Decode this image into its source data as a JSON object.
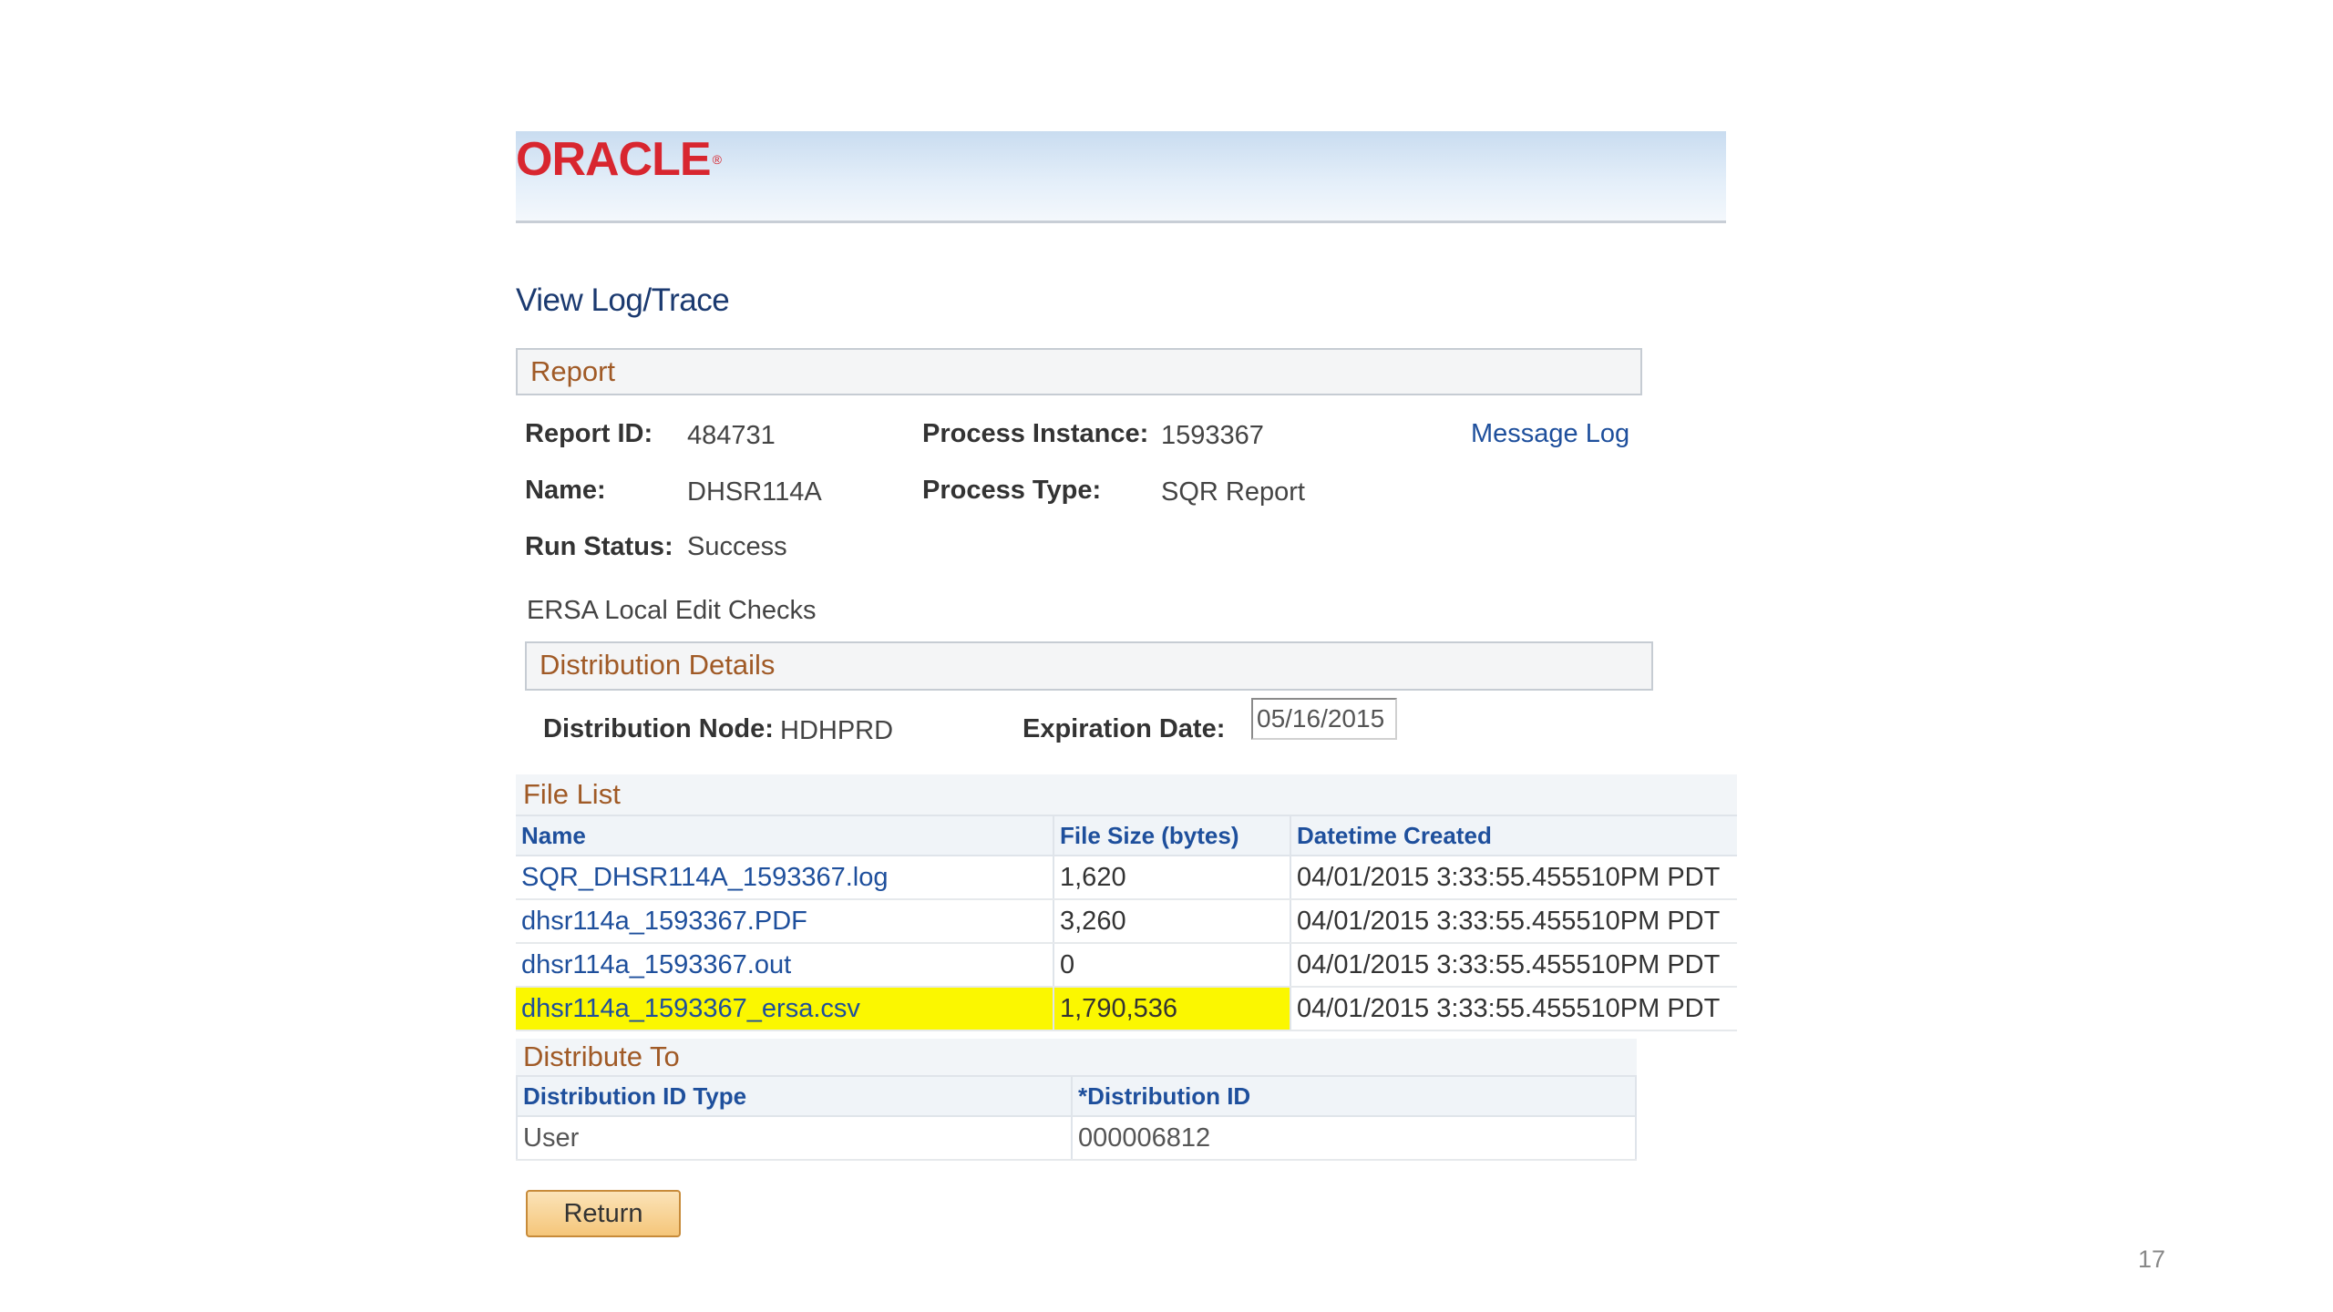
{
  "brand": {
    "logo_text": "ORACLE",
    "logo_mark": "®",
    "logo_color": "#d8262f"
  },
  "page": {
    "title": "View Log/Trace"
  },
  "report": {
    "section_title": "Report",
    "report_id_label": "Report ID:",
    "report_id": "484731",
    "process_instance_label": "Process Instance:",
    "process_instance": "1593367",
    "message_log_link": "Message Log",
    "name_label": "Name:",
    "name": "DHSR114A",
    "process_type_label": "Process Type:",
    "process_type": "SQR Report",
    "run_status_label": "Run Status:",
    "run_status": "Success",
    "description": "ERSA Local Edit Checks"
  },
  "distribution_details": {
    "section_title": "Distribution Details",
    "node_label": "Distribution Node:",
    "node": "HDHPRD",
    "expiration_label": "Expiration Date:",
    "expiration_date": "05/16/2015"
  },
  "file_list": {
    "title": "File List",
    "columns": [
      "Name",
      "File Size (bytes)",
      "Datetime Created"
    ],
    "rows": [
      {
        "name": "SQR_DHSR114A_1593367.log",
        "size": "1,620",
        "created": "04/01/2015  3:33:55.455510PM PDT"
      },
      {
        "name": "dhsr114a_1593367.PDF",
        "size": "3,260",
        "created": "04/01/2015  3:33:55.455510PM PDT"
      },
      {
        "name": "dhsr114a_1593367.out",
        "size": "0",
        "created": "04/01/2015  3:33:55.455510PM PDT"
      },
      {
        "name": "dhsr114a_1593367_ersa.csv",
        "size": "1,790,536",
        "created": "04/01/2015  3:33:55.455510PM PDT"
      }
    ],
    "highlight_color": "#fbf700"
  },
  "distribute_to": {
    "title": "Distribute To",
    "columns": [
      "Distribution ID Type",
      "*Distribution ID"
    ],
    "rows": [
      {
        "type": "User",
        "id": "000006812"
      }
    ]
  },
  "buttons": {
    "return_label": "Return"
  },
  "slide": {
    "number": "17"
  }
}
